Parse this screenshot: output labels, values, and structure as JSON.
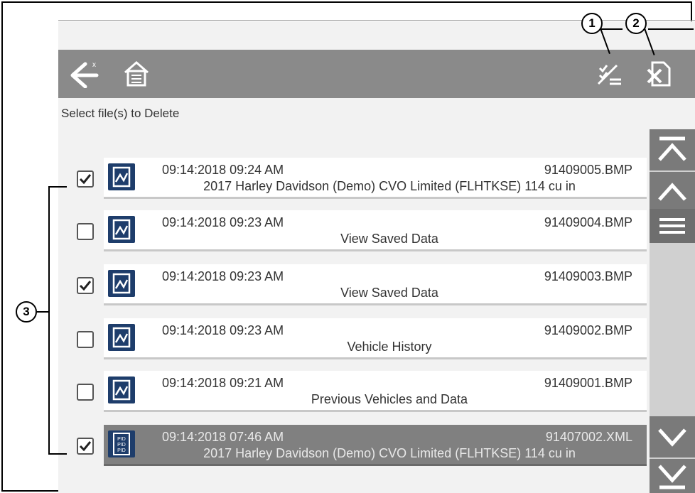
{
  "instruction": "Select file(s) to Delete",
  "toolbar": {
    "back_icon": "back-arrow-icon",
    "home_icon": "home-icon",
    "select_all_icon": "select-all-icon",
    "delete_icon": "delete-icon"
  },
  "files": [
    {
      "date": "09:14:2018 09:24 AM",
      "filename": "91409005.BMP",
      "description": "2017 Harley Davidson (Demo) CVO Limited (FLHTKSE) 114 cu in",
      "checked": true,
      "type": "image"
    },
    {
      "date": "09:14:2018 09:23 AM",
      "filename": "91409004.BMP",
      "description": "View Saved Data",
      "checked": false,
      "type": "image"
    },
    {
      "date": "09:14:2018 09:23 AM",
      "filename": "91409003.BMP",
      "description": "View Saved Data",
      "checked": true,
      "type": "image"
    },
    {
      "date": "09:14:2018 09:23 AM",
      "filename": "91409002.BMP",
      "description": "Vehicle History",
      "checked": false,
      "type": "image"
    },
    {
      "date": "09:14:2018 09:21 AM",
      "filename": "91409001.BMP",
      "description": "Previous Vehicles and Data",
      "checked": false,
      "type": "image"
    },
    {
      "date": "09:14:2018 07:46 AM",
      "filename": "91407002.XML",
      "description": "2017 Harley Davidson (Demo) CVO Limited (FLHTKSE) 114 cu in",
      "checked": true,
      "type": "xml",
      "selected": true
    }
  ],
  "callouts": {
    "c1": "1",
    "c2": "2",
    "c3": "3"
  },
  "colors": {
    "toolbar": "#8a8a8a",
    "file_icon": "#1e3d6b",
    "selected_row": "#808080"
  }
}
